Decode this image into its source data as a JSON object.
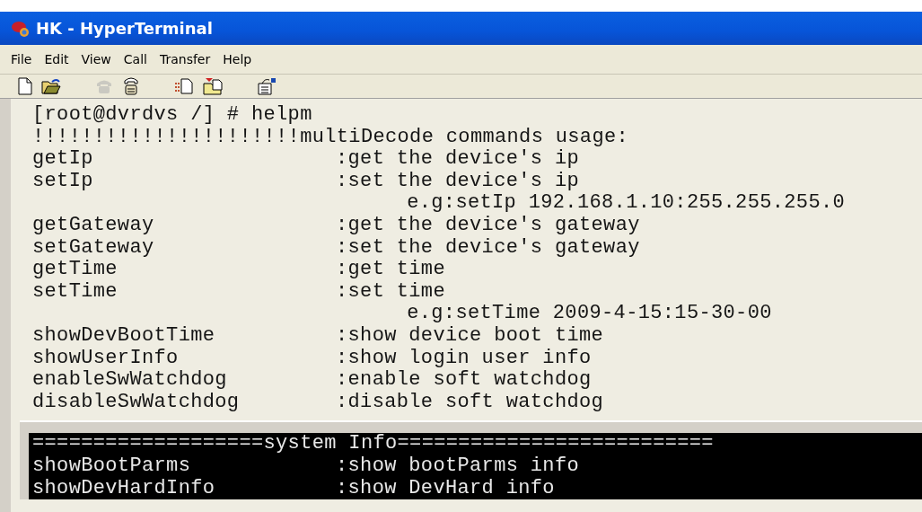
{
  "window": {
    "title": "HK - HyperTerminal"
  },
  "menu": [
    "File",
    "Edit",
    "View",
    "Call",
    "Transfer",
    "Help"
  ],
  "toolbar": [
    {
      "kind": "new",
      "disabled": false
    },
    {
      "kind": "open",
      "disabled": false
    },
    {
      "kind": "call",
      "disabled": true
    },
    {
      "kind": "disconnect",
      "disabled": false
    },
    {
      "kind": "send",
      "disabled": false
    },
    {
      "kind": "receive",
      "disabled": false
    },
    {
      "kind": "properties",
      "disabled": false
    }
  ],
  "terminal": {
    "lines": [
      {
        "kind": "text",
        "text": "[root@dvrdvs /] # helpm"
      },
      {
        "kind": "text",
        "text": "!!!!!!!!!!!!!!!!!!!!!!multiDecode commands usage:"
      },
      {
        "kind": "command",
        "command": "getIp",
        "description": ":get the device's ip"
      },
      {
        "kind": "command",
        "command": "setIp",
        "description": ":set the device's ip"
      },
      {
        "kind": "example",
        "text": "e.g:setIp 192.168.1.10:255.255.255.0"
      },
      {
        "kind": "command",
        "command": "getGateway",
        "description": ":get the device's gateway"
      },
      {
        "kind": "command",
        "command": "setGateway",
        "description": ":set the device's gateway"
      },
      {
        "kind": "command",
        "command": "getTime",
        "description": ":get time"
      },
      {
        "kind": "command",
        "command": "setTime",
        "description": ":set time"
      },
      {
        "kind": "example",
        "text": "e.g:setTime 2009-4-15:15-30-00"
      },
      {
        "kind": "command",
        "command": "showDevBootTime",
        "description": ":show device boot time"
      },
      {
        "kind": "command",
        "command": "showUserInfo",
        "description": ":show login user info"
      },
      {
        "kind": "command",
        "command": "enableSwWatchdog",
        "description": ":enable soft watchdog"
      },
      {
        "kind": "command",
        "command": "disableSwWatchdog",
        "description": ":disable soft watchdog"
      }
    ]
  },
  "console": {
    "lines": [
      {
        "kind": "text",
        "text": "===================system Info=========================="
      },
      {
        "kind": "command",
        "command": "showBootParms",
        "description": ":show bootParms info"
      },
      {
        "kind": "command",
        "command": "showDevHardInfo",
        "description": ":show DevHard info"
      }
    ]
  }
}
